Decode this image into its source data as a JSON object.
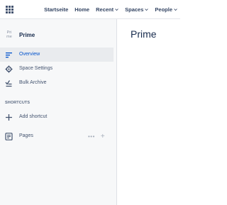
{
  "topbar": {
    "app_switcher_icon": "grid-icon",
    "nav": [
      {
        "label": "Startseite",
        "dropdown": false
      },
      {
        "label": "Home",
        "dropdown": false
      },
      {
        "label": "Recent",
        "dropdown": true
      },
      {
        "label": "Spaces",
        "dropdown": true
      },
      {
        "label": "People",
        "dropdown": true
      }
    ]
  },
  "sidebar": {
    "space": {
      "avatar_line1": "Pri",
      "avatar_line2": "me",
      "name": "Prime"
    },
    "items": [
      {
        "label": "Overview",
        "icon": "overview-icon",
        "active": true
      },
      {
        "label": "Space Settings",
        "icon": "gear-icon",
        "active": false
      },
      {
        "label": "Bulk Archive",
        "icon": "archive-icon",
        "active": false
      }
    ],
    "shortcuts": {
      "heading": "SHORTCUTS",
      "add_label": "Add shortcut"
    },
    "pages": {
      "label": "Pages",
      "more": "•••",
      "add": "+"
    }
  },
  "main": {
    "title": "Prime"
  },
  "colors": {
    "accent": "#0052cc",
    "sidebar_bg": "#f7f8f9",
    "text": "#172b4d"
  }
}
